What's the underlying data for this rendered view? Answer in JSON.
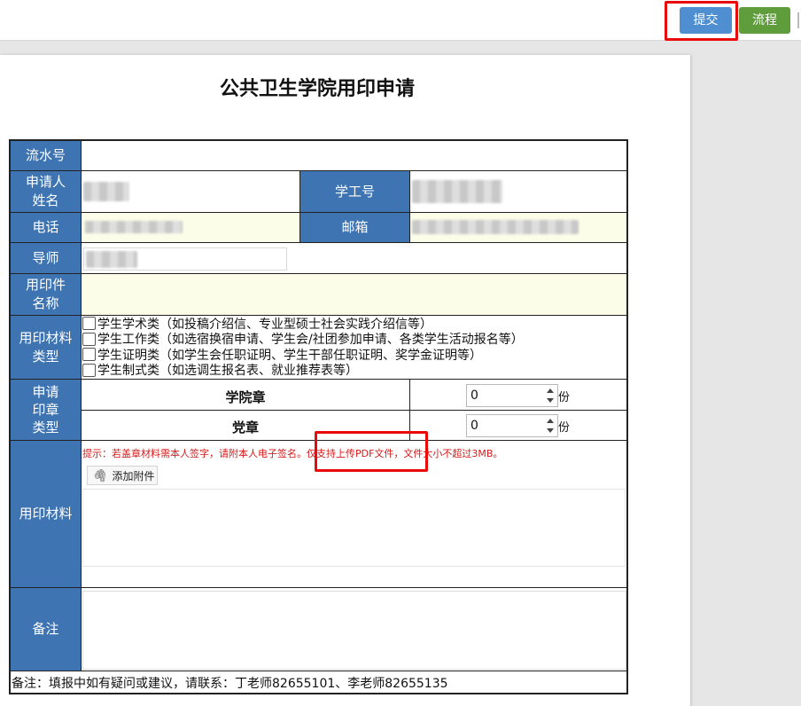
{
  "toolbar": {
    "submit_label": "提交",
    "flow_label": "流程"
  },
  "form": {
    "title": "公共卫生学院用印申请",
    "labels": {
      "serial": "流水号",
      "applicant": "申请人\n姓名",
      "student_id": "学工号",
      "phone": "电话",
      "email": "邮箱",
      "tutor": "导师",
      "item_name": "用印件\n名称",
      "material_type": "用印材料\n类型",
      "seal_type": "申请\n印章\n类型",
      "material": "用印材料",
      "remarks": "备注"
    },
    "material_options": [
      "学生学术类（如投稿介绍信、专业型硕士社会实践介绍信等）",
      "学生工作类（如选宿换宿申请、学生会/社团参加申请、各类学生活动报名等）",
      "学生证明类（如学生会任职证明、学生干部任职证明、奖学金证明等）",
      "学生制式类（如选调生报名表、就业推荐表等）"
    ],
    "seals": [
      {
        "name": "学院章",
        "value": "0",
        "unit": "份"
      },
      {
        "name": "党章",
        "value": "0",
        "unit": "份"
      }
    ],
    "hint": "提示：若盖章材料需本人签字，请附本人电子签名。仅支持上传PDF文件，文件大小不超过3MB。",
    "attach_label": "添加附件",
    "footer_note": "备注：填报中如有疑问或建议，请联系：丁老师82655101、李老师82655135"
  },
  "colors": {
    "label_bg": "#3e74b2",
    "submit_btn": "#4e8ed1",
    "flow_btn": "#5f9d3c",
    "highlight": "#ea0a0a",
    "hint_text": "#d71a1a",
    "yellow_field": "#fcfde8"
  },
  "icons": {
    "attach": "paperclip-icon"
  }
}
